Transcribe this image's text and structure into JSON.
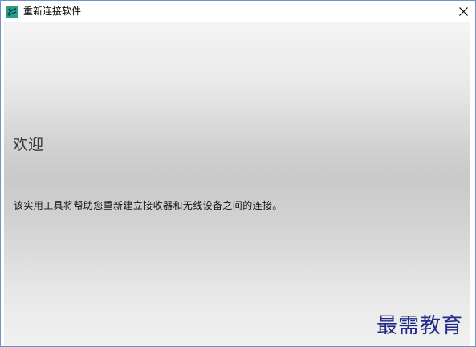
{
  "window": {
    "title": "重新连接软件",
    "icon": "unifying-app-icon",
    "close_icon": "close-icon"
  },
  "content": {
    "heading": "欢迎",
    "description": "该实用工具将帮助您重新建立接收器和无线设备之间的连接。"
  },
  "watermark": {
    "text": "最需教育"
  },
  "colors": {
    "window_border": "#6f93c9",
    "app_icon_green": "#2a9d8f",
    "watermark": "#1f2a8a"
  }
}
